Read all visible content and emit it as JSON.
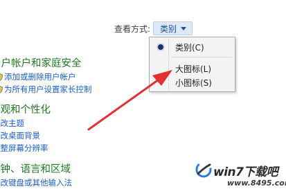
{
  "view_by": {
    "label": "查看方式:",
    "selected": "类别"
  },
  "categories": [
    {
      "title": "用户帐户和家庭安全",
      "links": [
        "添加或删除用户帐户",
        "为所有用户设置家长控制"
      ]
    },
    {
      "title": "外观和个性化",
      "links": [
        "更改主题",
        "更改桌面背景",
        "调整屏幕分辨率"
      ]
    },
    {
      "title": "时钟、语言和区域",
      "links": [
        "更改键盘或其他输入法"
      ]
    }
  ],
  "menu": {
    "items": [
      {
        "label": "类别(C)",
        "checked": true
      },
      {
        "label": "大图标(L)",
        "checked": false
      },
      {
        "label": "小图标(S)",
        "checked": false
      }
    ]
  },
  "watermark": {
    "brand": "win7下载吧",
    "url": "www.8495.com"
  },
  "colors": {
    "category_title": "#1e7a21",
    "link": "#1a5fc7",
    "arrow": "#e53030"
  }
}
